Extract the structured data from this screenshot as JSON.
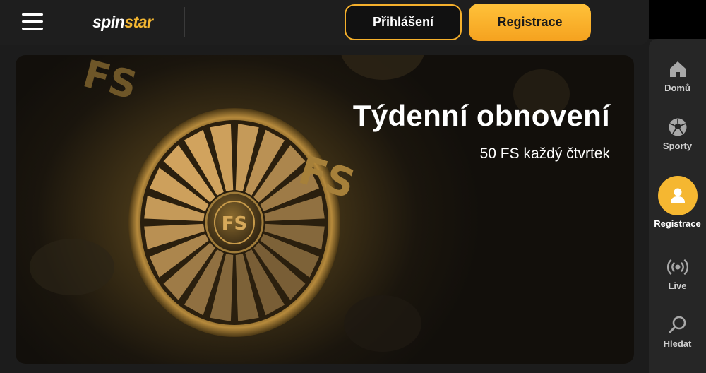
{
  "header": {
    "logo": {
      "part1": "spin",
      "part2": "star"
    },
    "login_label": "Přihlášení",
    "register_label": "Registrace"
  },
  "banner": {
    "title": "Týdenní obnovení",
    "subtitle": "50 FS každý čtvrtek",
    "wheel_center_text": "FS",
    "tag_text": "FS"
  },
  "sidebar": {
    "items": [
      {
        "label": "Domů",
        "icon": "home-icon"
      },
      {
        "label": "Sporty",
        "icon": "soccer-ball-icon"
      },
      {
        "label": "Registrace",
        "icon": "user-icon",
        "active": true
      },
      {
        "label": "Live",
        "icon": "live-broadcast-icon"
      },
      {
        "label": "Hledat",
        "icon": "search-icon"
      }
    ]
  },
  "colors": {
    "accent": "#f5b731",
    "header_bg": "#1e1e1e",
    "sidebar_bg": "#262626"
  }
}
